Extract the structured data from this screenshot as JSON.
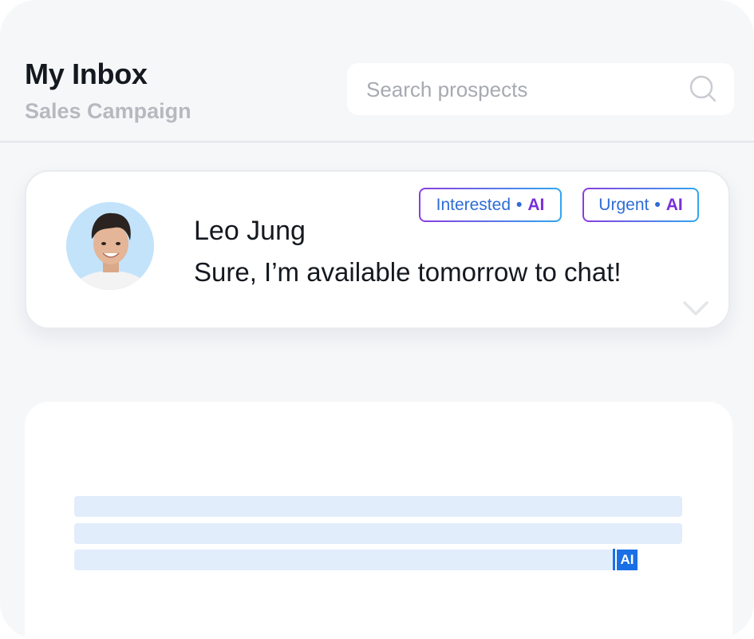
{
  "header": {
    "title": "My Inbox",
    "subtitle": "Sales Campaign"
  },
  "search": {
    "placeholder": "Search prospects",
    "icon": "search-icon"
  },
  "conversation": {
    "name": "Leo Jung",
    "message": "Sure, I’m available tomorrow to chat!",
    "tags": [
      {
        "label": "Interested",
        "separator": "•",
        "ai": "AI"
      },
      {
        "label": "Urgent",
        "separator": "•",
        "ai": "AI"
      }
    ],
    "expand_icon": "chevron-down-icon"
  },
  "composer": {
    "ai_badge": "AI"
  },
  "colors": {
    "background": "#f6f7f9",
    "tag_text": "#2e6dd6",
    "tag_ai": "#7a2fd8",
    "ai_badge": "#1a6fe6",
    "skeleton": "#e2edfb"
  }
}
